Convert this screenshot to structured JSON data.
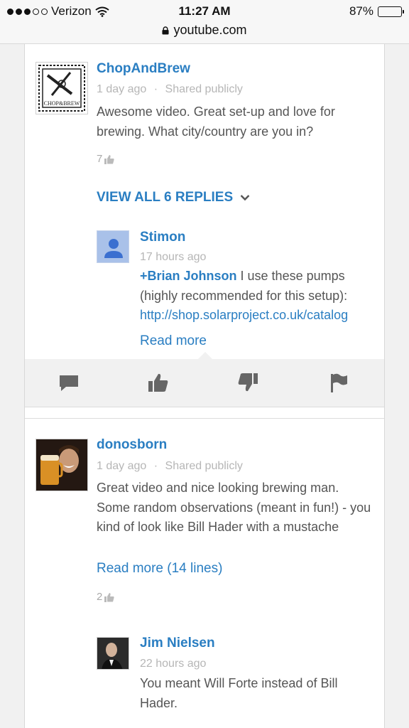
{
  "status_bar": {
    "carrier": "Verizon",
    "time": "11:27 AM",
    "battery": "87%",
    "battery_level": 0.87,
    "url": "youtube.com"
  },
  "comments": [
    {
      "author": "ChopAndBrew",
      "time": "1 day ago",
      "visibility": "Shared publicly",
      "text": "Awesome video. Great set-up and love for brewing. What city/country are you in?",
      "likes": "7",
      "view_replies": "VIEW ALL 6 REPLIES",
      "avatar_text": "CHOP&BREW"
    },
    {
      "author": "donosborn",
      "time": "1 day ago",
      "visibility": "Shared publicly",
      "text": "Great video and nice looking brewing man. Some random observations (meant in fun!) - you kind of look like Bill Hader with a mustache",
      "read_more": "Read more (14 lines)",
      "likes": "2"
    }
  ],
  "replies": [
    {
      "author": "Stimon",
      "time": "17 hours ago",
      "mention": "+Brian Johnson",
      "text": " I use these pumps (highly recommended for this setup):",
      "link": "http://shop.solarproject.co.uk/catalog",
      "read_more": "Read more"
    },
    {
      "author": "Jim Nielsen",
      "time": "22 hours ago",
      "text": "You meant Will Forte instead of Bill Hader."
    }
  ],
  "meta_separator": "·",
  "icons": {
    "reply": "comment-icon",
    "like": "thumbs-up-icon",
    "dislike": "thumbs-down-icon",
    "flag": "flag-icon"
  },
  "colors": {
    "link_blue": "#2a7ec2",
    "meta_gray": "#b6b6b6",
    "body_gray": "#555555",
    "action_bar_bg": "#f1f1f1"
  }
}
